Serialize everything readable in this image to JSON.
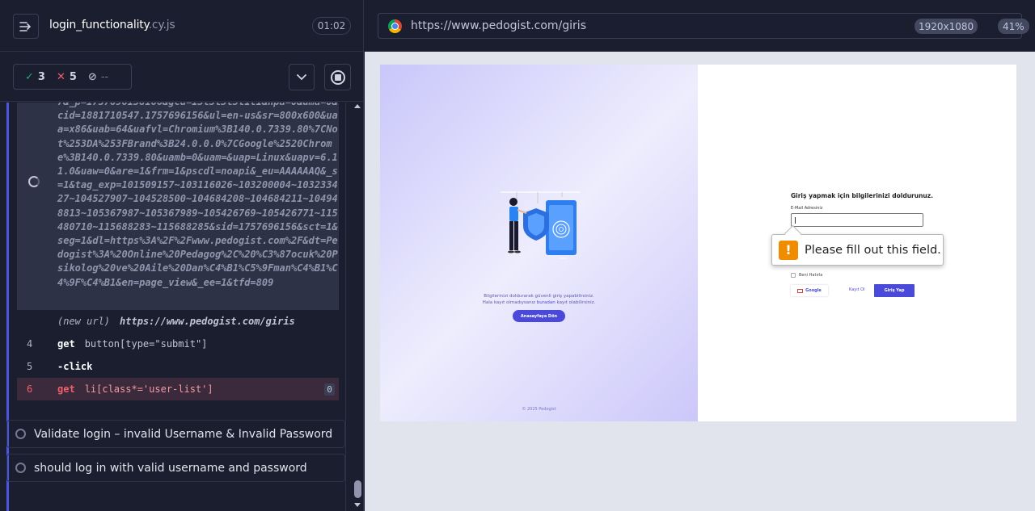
{
  "spec": {
    "name": "login_functionality",
    "ext": ".cy.js",
    "timer": "01:02"
  },
  "stats": {
    "passed": "3",
    "failed": "5",
    "pending": "--"
  },
  "log": {
    "url_text": "7&_p=1757696158166&gcd=13l3l3l3l1l1&npa=0&dma=0&cid=1881710547.1757696156&ul=en-us&sr=800x600&uaa=x86&uab=64&uafvl=Chromium%3B140.0.7339.80%7CNot%253DA%253FBrand%3B24.0.0.0%7CGoogle%2520Chrome%3B140.0.7339.80&uamb=0&uam=&uap=Linux&uapv=6.11.0&uaw=0&are=1&frm=1&pscdl=noapi&_eu=AAAAAAQ&_s=1&tag_exp=101509157~103116026~103200004~103233427~104527907~104528500~104684208~104684211~104948813~105367987~105367989~105426769~105426771~115480710~115688283~115688285&sid=1757696156&sct=1&seg=1&dl=https%3A%2F%2Fwww.pedogist.com%2F&dt=Pedogist%3A%20Online%20Pedagog%2C%20%C3%87ocuk%20Psikolog%20ve%20Aile%20Dan%C4%B1%C5%9Fman%C4%B1%C4%9F%C4%B1&en=page_view&_ee=1&tfd=809",
    "new_url_label": "(new url)",
    "new_url_value": "https://www.pedogist.com/giris",
    "rows": [
      {
        "num": "4",
        "cmd": "get",
        "arg": "button[type=\"submit\"]"
      },
      {
        "num": "5",
        "cmd": "-click",
        "arg": ""
      },
      {
        "num": "6",
        "cmd": "get",
        "arg": "li[class*='user-list']",
        "count": "0"
      }
    ]
  },
  "tests": [
    {
      "title": "Validate login – invalid Username & Invalid Password"
    },
    {
      "title": "should log in with valid username and password"
    }
  ],
  "aut": {
    "url": "https://www.pedogist.com/giris",
    "viewport": "1920x1080",
    "zoom": "41%"
  },
  "page": {
    "hero_line1": "Bilgilerinizi doldurarak güvenli giriş yapabilirsiniz.",
    "hero_line2_pre": "Hala kayıt olmadıysanız ",
    "hero_line2_link": "buradan",
    "hero_line2_post": " kayıt olabilirsiniz.",
    "home_button": "Anasayfaya Dön",
    "copyright": "© 2025 Pedogist",
    "form_title": "Giriş yapmak için bilgilerinizi doldurunuz.",
    "email_label": "E-Mail Adresiniz",
    "remember_label": "Beni Hatırla",
    "google_button": "Google",
    "register_link": "Kayıt Ol",
    "login_button": "Giriş Yap"
  },
  "validation": {
    "message": "Please fill out this field."
  },
  "colors": {
    "accent": "#4956e3",
    "pass": "#1fa971",
    "fail": "#f15f6c",
    "brand": "#4a49d9"
  }
}
